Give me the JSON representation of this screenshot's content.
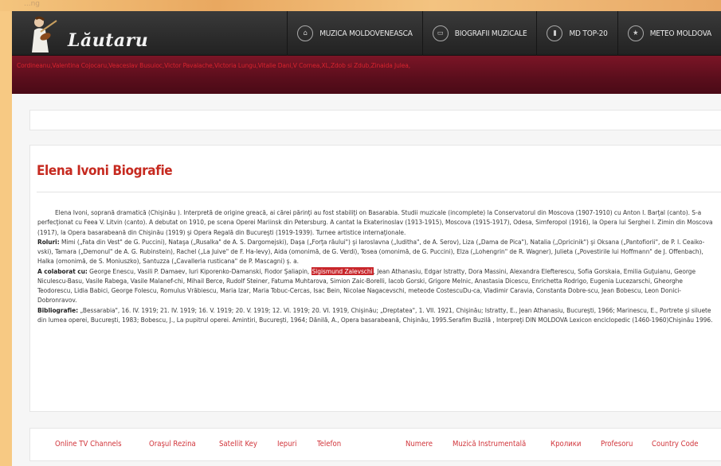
{
  "topstrip_text": "...ng",
  "brand": {
    "name": "Lăutaru"
  },
  "nav": [
    {
      "label": "MUZICA MOLDOVENEASCA",
      "icon": "home-icon"
    },
    {
      "label": "BIOGRAFII MUZICALE",
      "icon": "window-icon"
    },
    {
      "label": "MD TOP-20",
      "icon": "chart-icon"
    },
    {
      "label": "METEO MOLDOVA",
      "icon": "star-icon"
    }
  ],
  "ticker": "Cordineanu,Valentina Cojocaru,Veaceslav Busuioc,Victor Pavalache,Victoria Lungu,Vitalie Dani,V Cornea,XL,Zdob si Zdub,Zinaida Julea,",
  "article": {
    "title": "Elena Ivoni Biografie",
    "intro": "Elena Ivoni, soprană dramatică (Chişinău ). Interpretă de origine greacă, ai cărei părinţi au fost stabiliţi on Basarabia. Studii muzicale (incomplete) la Conservatorul din Moscova (1907-1910) cu Anton I. Barţal (canto). S-a perfecţionat cu Feea V. Litvin (canto). A debutat on 1910, pe scena Operei Mariinsk din Petersburg. A cantat la Ekaterinoslav (1913-1915), Moscova (1915-1917), Odesa, Simferopol (1916), la Opera lui Serghei I. Zimin din Moscova (1917), la Opera basarabeană din Chişinău (1919) şi Opera Regală din Bucureşti (1919-1939). Turnee artistice internaţionale.",
    "roles_label": "Roluri:",
    "roles": " Mimi („Fata din Vest\" de G. Puccini), Nataşa („Rusalka\" de A. S. Dargomejski), Daşa („Forţa răului\") şi Iaroslavna („Iuditha\", de A. Serov), Liza („Dama de Pica\"), Natalia („Opricinik\") şi Oksana („Pantofiorii\", de P. I. Ceaiko-vski), Tamara („Demonul\" de A. G. Rubinstein), Rachel („La Juive\" de F. Ha-levy), Aida (omonimă, de G. Verdi), Tosea (omonimă, de G. Puccini), Elza („Lohengrin\" de R. Wagner), Julieta („Povestirile lui Hoffmann\" de J. Offenbach), Halka (omonimă, de S. Moniuszko), Santuzza („Cavalleria rusticana\" de P. Mascagni) ş. a.",
    "collab_label": "A colaborat cu:",
    "collab_before": " George Enescu, Vasili P. Damaev, Iuri Kiporenko-Damanski, Fiodor Şaliapin, ",
    "collab_highlight": "Sigismund Zalevschi",
    "collab_after": ", Jean Athanasiu, Edgar Istratty, Dora Massini, Alexandra Elefterescu, Sofia Gorskaia, Emilia Guţuianu, George Niculescu-Basu, Vasile Rabega, Vasile Malanef-chi, Mihail Berce, Rudolf Steiner, Fatuma Muhtarova, Simion Zaic-Borelli, Iacob Gorski, Grigore Melnic, Anastasia Dicescu, Enrichetta Rodrigo, Eugenia Lucezarschi, Gheorghe Teodorescu, Lidia Babici, George Folescu, Romulus Vrăbiescu, Maria Izar, Maria Tobuc-Cercas, Isac Bein, Nicolae Nagacevschi, meteode CostescuDu-ca, Vladimir Caravia, Constanta Dobre-scu, Jean Bobescu, Leon Donici-Dobronravov.",
    "biblio_label": "Bibliografie:",
    "biblio": " „Bessarabia\", 16. IV. 1919; 21. IV. 1919; 16. V. 1919; 20. V. 1919; 12. VI. 1919; 20. VI. 1919, Chişinău; „Dreptatea\", 1. VII. 1921, Chişinău; Istratty, E., Jean Athanasiu, Bucureşti, 1966; Marinescu, E., Portrete şi siluete din lumea operei, Bucureşti, 1983; Bobescu, J., La pupitrul operei. Amintiri, Bucureşti, 1964; Dănilă, A., Opera basarabeană, Chişinău, 1995.Serafim Buzilă , Interpreţi DIN MOLDOVA Lexicon enciclopedic (1460-1960)Chişinău 1996."
  },
  "footer_links": [
    "Online TV Channels",
    "Oraşul Rezina",
    "Satellit Key",
    "Iepuri",
    "Telefon",
    "Numere",
    "Muzică Instrumentală",
    "Кролики",
    "Profesoru",
    "Country Code"
  ],
  "colors": {
    "accent": "#c62a20",
    "band": "#6a1120",
    "header": "#2b2b2b",
    "page_bg": "#f7c983"
  }
}
